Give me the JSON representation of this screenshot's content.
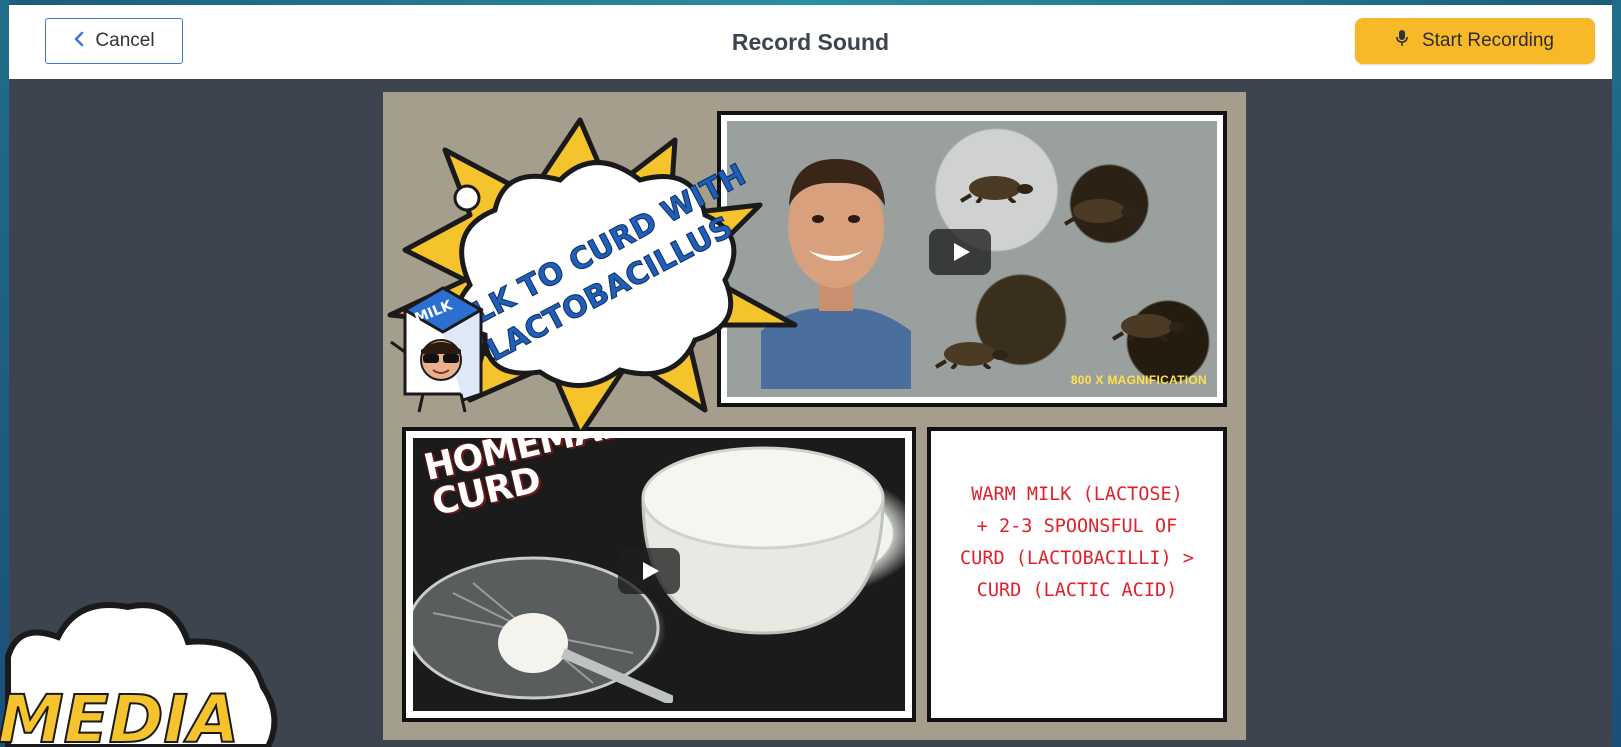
{
  "header": {
    "cancel_label": "Cancel",
    "title": "Record Sound",
    "record_label": "Start Recording"
  },
  "comic": {
    "burst_title": "MILK TO CURD WITH LACTOBACILLUS",
    "video1": {
      "overlay_text": "800 X MAGNIFICATION"
    },
    "video2": {
      "overlay_text": "HOMEMADE CURD"
    },
    "caption_lines": [
      "WARM MILK (LACTOSE)",
      "+ 2-3 SPOONSFUL OF",
      "CURD (LACTOBACILLI) >",
      "CURD (LACTIC ACID)"
    ],
    "milk_label": "MILK"
  },
  "background": {
    "media_label": "MEDIA"
  },
  "colors": {
    "header_bg": "#ffffff",
    "stage_bg": "#3d4450",
    "accent_blue": "#3a7bd5",
    "record_yellow": "#f7b928",
    "canvas_bg": "#a59e8c",
    "caption_red": "#e0212c",
    "burst_yellow": "#f5c32c",
    "title_blue": "#1f5fb8"
  },
  "icons": {
    "cancel": "chevron-left-icon",
    "record": "microphone-icon",
    "play": "play-icon"
  }
}
